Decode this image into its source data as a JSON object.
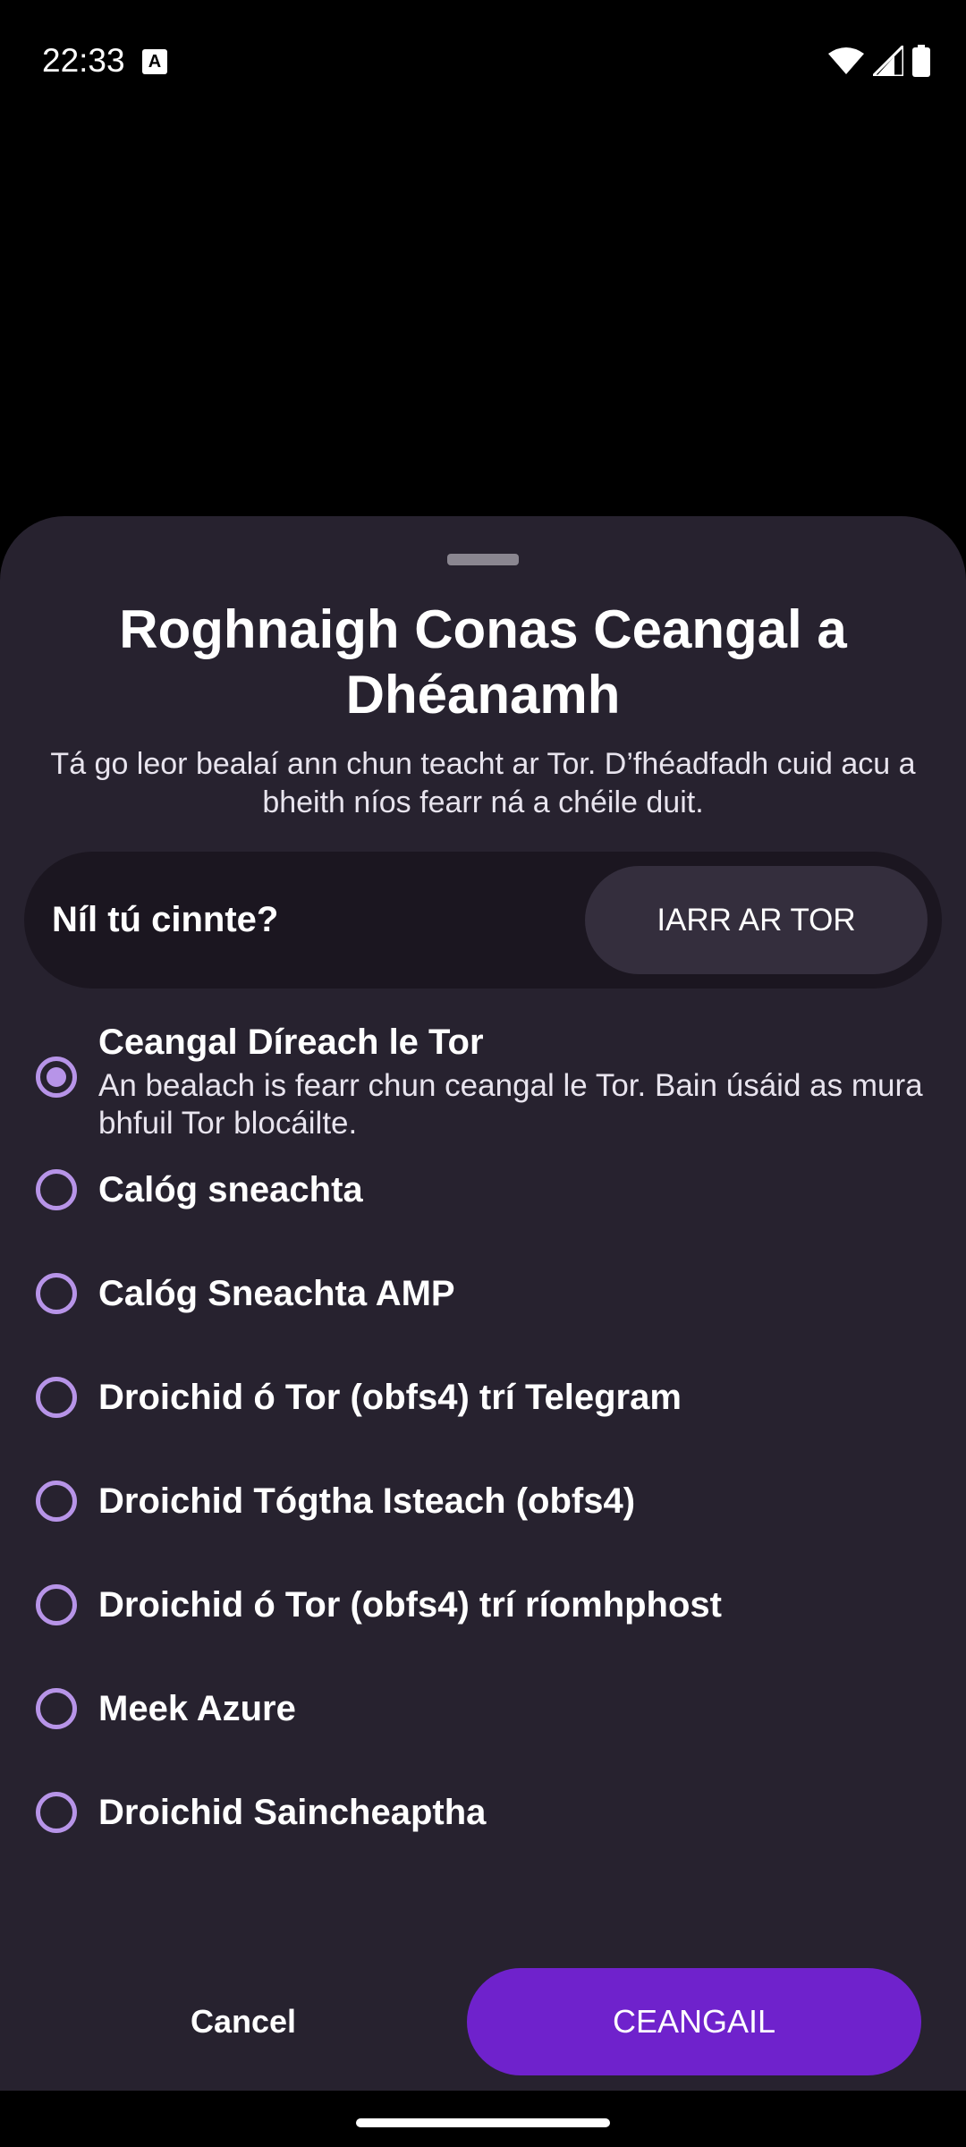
{
  "status_bar": {
    "time": "22:33",
    "notification_icon": "a-notification-icon",
    "icons": [
      "wifi-icon",
      "signal-icon",
      "battery-icon"
    ]
  },
  "sheet": {
    "title": "Roghnaigh Conas Ceangal a Dhéanamh",
    "subtitle": "Tá go leor bealaí ann chun teacht ar Tor. D’fhéadfadh cuid acu a bheith níos fearr ná a chéile duit.",
    "help": {
      "label": "Níl tú cinnte?",
      "button_label": "IARR AR TOR"
    },
    "options": [
      {
        "label": "Ceangal Díreach le Tor",
        "description": "An bealach is fearr chun ceangal le Tor. Bain úsáid as mura bhfuil Tor blocáilte.",
        "selected": true
      },
      {
        "label": "Calóg sneachta",
        "selected": false
      },
      {
        "label": "Calóg Sneachta AMP",
        "selected": false
      },
      {
        "label": "Droichid ó Tor (obfs4) trí Telegram",
        "selected": false
      },
      {
        "label": "Droichid Tógtha Isteach (obfs4)",
        "selected": false
      },
      {
        "label": "Droichid ó Tor (obfs4) trí ríomhphost",
        "selected": false
      },
      {
        "label": "Meek Azure",
        "selected": false
      },
      {
        "label": "Droichid Saincheaptha",
        "selected": false
      }
    ],
    "cancel_label": "Cancel",
    "connect_label": "CEANGAIL"
  },
  "colors": {
    "sheet_background": "#27222f",
    "accent": "#6f22cc",
    "radio": "#b794e8"
  }
}
